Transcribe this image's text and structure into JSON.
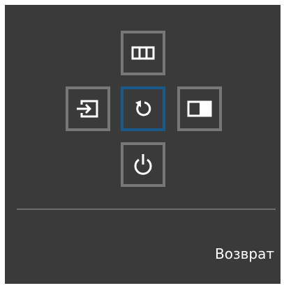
{
  "menu": {
    "top": {
      "icon": "picture-mode-icon"
    },
    "left": {
      "icon": "source-input-icon"
    },
    "center": {
      "icon": "return-icon",
      "selected": true
    },
    "right": {
      "icon": "pip-icon"
    },
    "bottom": {
      "icon": "power-icon"
    }
  },
  "caption": "Возврат",
  "colors": {
    "background": "#3a3a3a",
    "button_border": "#777777",
    "selected_border": "#1a5a8a",
    "icon": "#ffffff",
    "divider": "#6c6c6c"
  }
}
